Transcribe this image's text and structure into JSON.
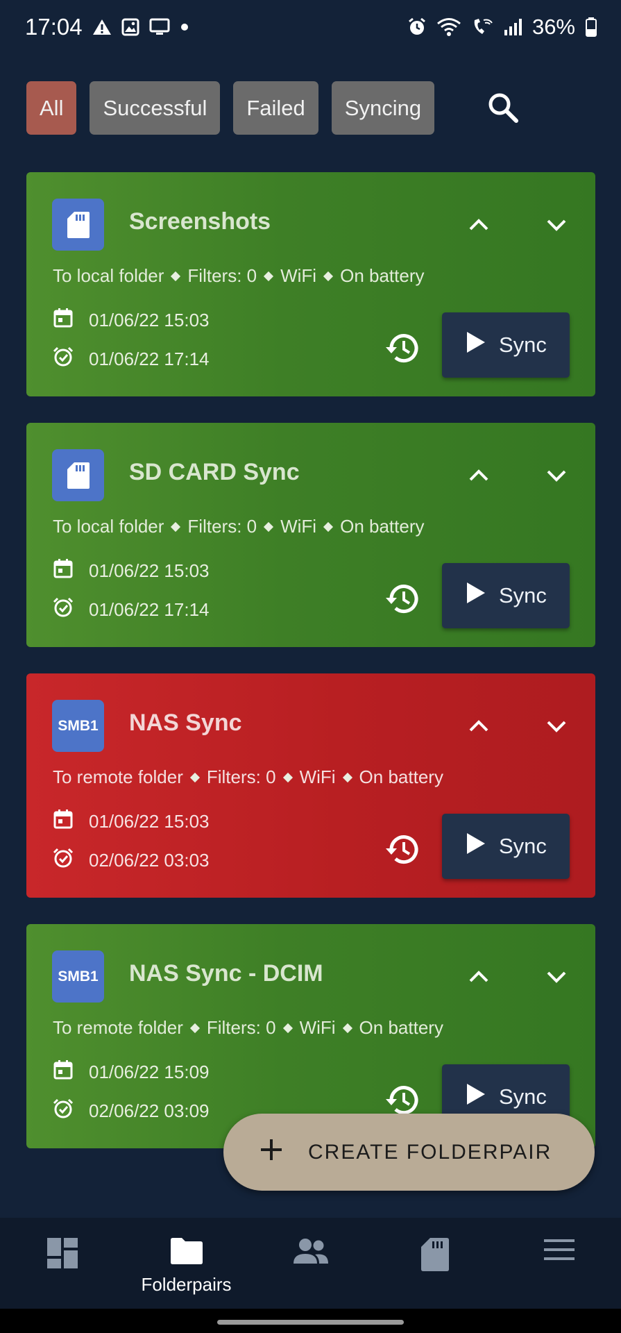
{
  "status_bar": {
    "time": "17:04",
    "battery": "36%",
    "left_icons": [
      "warning-icon",
      "image-icon",
      "cast-icon",
      "dot-icon"
    ],
    "right_icons": [
      "alarm-icon",
      "wifi-icon",
      "wifi-call-icon",
      "signal-icon",
      "battery-icon"
    ]
  },
  "filters": {
    "chips": [
      "All",
      "Successful",
      "Failed",
      "Syncing"
    ],
    "active": "All",
    "active_color": "#a75a4f",
    "chip_color": "#6b6b6b"
  },
  "cards": [
    {
      "icon": "sd-card-icon",
      "icon_text": "",
      "title": "Screenshots",
      "status": "success",
      "sub": [
        "To local folder",
        "Filters: 0",
        "WiFi",
        "On battery"
      ],
      "last_sync": "01/06/22 15:03",
      "next_sync": "01/06/22 17:14",
      "sync_label": "Sync"
    },
    {
      "icon": "sd-card-icon",
      "icon_text": "",
      "title": "SD CARD Sync",
      "status": "success",
      "sub": [
        "To local folder",
        "Filters: 0",
        "WiFi",
        "On battery"
      ],
      "last_sync": "01/06/22 15:03",
      "next_sync": "01/06/22 17:14",
      "sync_label": "Sync"
    },
    {
      "icon": "smb-icon",
      "icon_text": "SMB1",
      "title": "NAS Sync",
      "status": "failed",
      "sub": [
        "To remote folder",
        "Filters: 0",
        "WiFi",
        "On battery"
      ],
      "last_sync": "01/06/22 15:03",
      "next_sync": "02/06/22 03:03",
      "sync_label": "Sync"
    },
    {
      "icon": "smb-icon",
      "icon_text": "SMB1",
      "title": "NAS Sync - DCIM",
      "status": "success",
      "sub": [
        "To remote folder",
        "Filters: 0",
        "WiFi",
        "On battery"
      ],
      "last_sync": "01/06/22 15:09",
      "next_sync": "02/06/22 03:09",
      "sync_label": "Sync"
    }
  ],
  "colors": {
    "background": "#132238",
    "success": "#3e7f26",
    "failed": "#b81f22",
    "sync_button": "#22324a",
    "icon_badge": "#4d74c8",
    "fab": "#b9ab96"
  },
  "fab": {
    "label": "CREATE FOLDERPAIR",
    "icon": "plus-icon"
  },
  "bottom_nav": {
    "items": [
      {
        "icon": "dashboard-icon",
        "label": ""
      },
      {
        "icon": "folder-icon",
        "label": "Folderpairs"
      },
      {
        "icon": "accounts-icon",
        "label": ""
      },
      {
        "icon": "sd-card-icon",
        "label": ""
      },
      {
        "icon": "menu-icon",
        "label": ""
      }
    ],
    "active": "Folderpairs"
  }
}
